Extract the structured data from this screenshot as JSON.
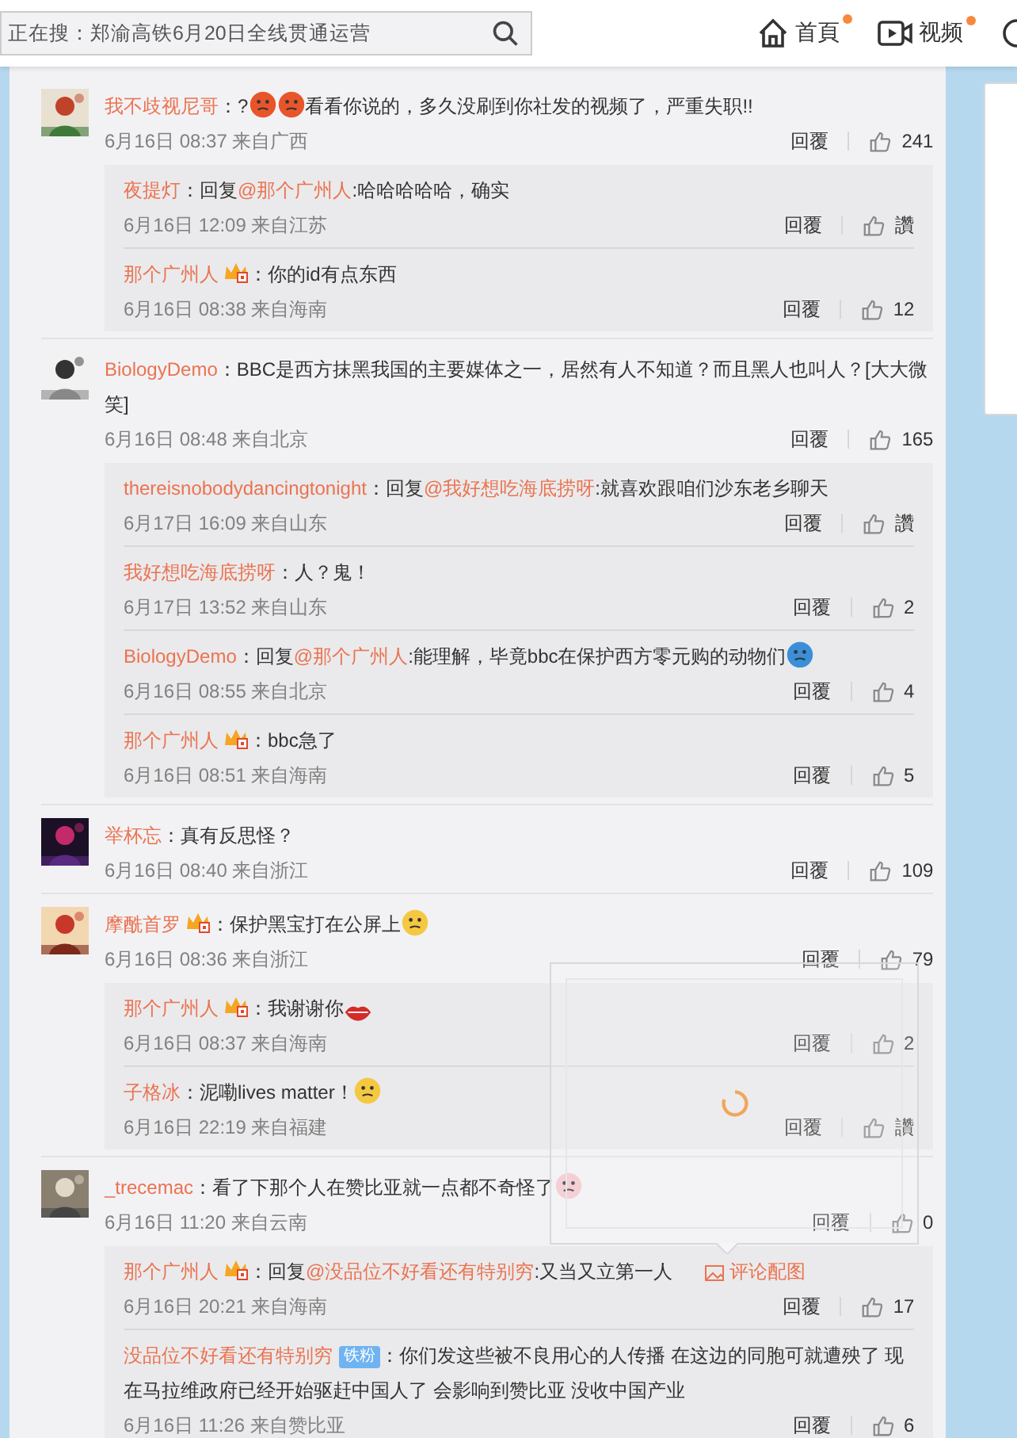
{
  "search": {
    "placeholder": "正在搜：郑渝高铁6月20日全线贯通运营"
  },
  "nav": [
    {
      "kind": "home",
      "label": "首頁",
      "dot": true
    },
    {
      "kind": "video",
      "label": "视频",
      "dot": true
    }
  ],
  "comments": [
    {
      "user": "我不歧视尼哥",
      "parts": [
        {
          "kind": "text",
          "text": "：?"
        },
        {
          "kind": "face",
          "color": "#e8552a"
        },
        {
          "kind": "face",
          "color": "#e8552a"
        },
        {
          "kind": "text",
          "text": "看看你说的，多久没刷到你社发的视频了，严重失职!!"
        }
      ],
      "time": "6月16日 08:37 来自广西",
      "reply": "回覆",
      "likes": "241",
      "replies": [
        {
          "user": "夜提灯",
          "parts": [
            {
              "kind": "text",
              "text": "：回复"
            },
            {
              "kind": "mention",
              "text": "@那个广州人"
            },
            {
              "kind": "text",
              "text": ":哈哈哈哈哈，确实"
            }
          ],
          "time": "6月16日 12:09 来自江苏",
          "reply": "回覆",
          "likes": "讚"
        },
        {
          "user": "那个广州人",
          "badge": {
            "kind": "crown"
          },
          "parts": [
            {
              "kind": "text",
              "text": "：你的id有点东西"
            }
          ],
          "time": "6月16日 08:38 来自海南",
          "reply": "回覆",
          "likes": "12"
        }
      ]
    },
    {
      "user": "BiologyDemo",
      "parts": [
        {
          "kind": "text",
          "text": "：BBC是西方抹黑我国的主要媒体之一，居然有人不知道？而且黑人也叫人？[大大微笑]"
        }
      ],
      "time": "6月16日 08:48 来自北京",
      "reply": "回覆",
      "likes": "165",
      "replies": [
        {
          "user": "thereisnobodydancingtonight",
          "parts": [
            {
              "kind": "text",
              "text": "：回复"
            },
            {
              "kind": "mention",
              "text": "@我好想吃海底捞呀"
            },
            {
              "kind": "text",
              "text": ":就喜欢跟咱们沙东老乡聊天"
            }
          ],
          "time": "6月17日 16:09 来自山东",
          "reply": "回覆",
          "likes": "讚"
        },
        {
          "user": "我好想吃海底捞呀",
          "parts": [
            {
              "kind": "text",
              "text": "：人？鬼！"
            }
          ],
          "time": "6月17日 13:52 来自山东",
          "reply": "回覆",
          "likes": "2"
        },
        {
          "user": "BiologyDemo",
          "parts": [
            {
              "kind": "text",
              "text": "：回复"
            },
            {
              "kind": "mention",
              "text": "@那个广州人"
            },
            {
              "kind": "text",
              "text": ":能理解，毕竟bbc在保护西方零元购的动物们"
            },
            {
              "kind": "face",
              "color": "#3a8fd8"
            }
          ],
          "time": "6月16日 08:55 来自北京",
          "reply": "回覆",
          "likes": "4"
        },
        {
          "user": "那个广州人",
          "badge": {
            "kind": "crown"
          },
          "parts": [
            {
              "kind": "text",
              "text": "：bbc急了"
            }
          ],
          "time": "6月16日 08:51 来自海南",
          "reply": "回覆",
          "likes": "5"
        }
      ]
    },
    {
      "user": "举杯忘",
      "parts": [
        {
          "kind": "text",
          "text": "：真有反思怪？"
        }
      ],
      "time": "6月16日 08:40 来自浙江",
      "reply": "回覆",
      "likes": "109"
    },
    {
      "user": "摩酰首罗",
      "badge": {
        "kind": "crown"
      },
      "parts": [
        {
          "kind": "text",
          "text": "：保护黑宝打在公屏上"
        },
        {
          "kind": "face",
          "color": "#f5c842"
        }
      ],
      "time": "6月16日 08:36 来自浙江",
      "reply": "回覆",
      "likes": "79",
      "replies": [
        {
          "user": "那个广州人",
          "badge": {
            "kind": "crown"
          },
          "parts": [
            {
              "kind": "text",
              "text": "：我谢谢你"
            },
            {
              "kind": "lips",
              "color": "#d42b2b"
            }
          ],
          "time": "6月16日 08:37 来自海南",
          "reply": "回覆",
          "likes": "2"
        },
        {
          "user": "子格冰",
          "parts": [
            {
              "kind": "text",
              "text": "：泥嘞lives matter！"
            },
            {
              "kind": "face",
              "color": "#f5c842"
            }
          ],
          "time": "6月16日 22:19 来自福建",
          "reply": "回覆",
          "likes": "讚"
        }
      ]
    },
    {
      "user": "_trecemac",
      "parts": [
        {
          "kind": "text",
          "text": "：看了下那个人在赞比亚就一点都不奇怪了"
        },
        {
          "kind": "face",
          "color": "#f4c6cc"
        }
      ],
      "time": "6月16日 11:20 来自云南",
      "reply": "回覆",
      "likes": "0",
      "replies": [
        {
          "user": "那个广州人",
          "badge": {
            "kind": "crown"
          },
          "parts": [
            {
              "kind": "text",
              "text": "：回复"
            },
            {
              "kind": "mention",
              "text": "@没品位不好看还有特别穷"
            },
            {
              "kind": "text",
              "text": ":又当又立第一人"
            }
          ],
          "link": "评论配图",
          "time": "6月16日 20:21 来自海南",
          "reply": "回覆",
          "likes": "17"
        },
        {
          "user": "没品位不好看还有特别穷",
          "badge": {
            "kind": "tag",
            "text": "铁粉"
          },
          "parts": [
            {
              "kind": "text",
              "text": "：你们发这些被不良用心的人传播 在这边的同胞可就遭殃了 现在马拉维政府已经开始驱赶中国人了 会影响到赞比亚 没收中国产业"
            }
          ],
          "time": "6月16日 11:26 来自赞比亚",
          "reply": "回覆",
          "likes": "6"
        }
      ]
    }
  ],
  "popup": {
    "loading": true
  }
}
